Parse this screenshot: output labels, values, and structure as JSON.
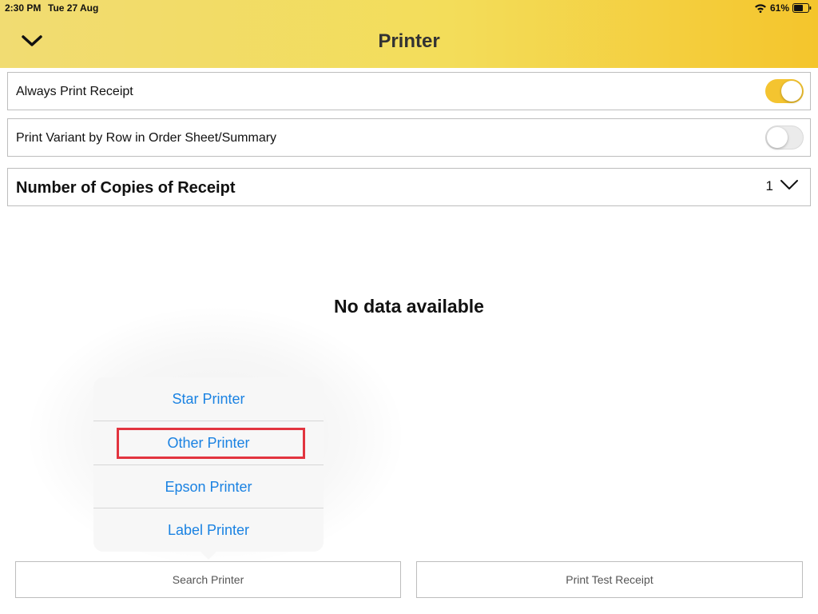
{
  "status_bar": {
    "time": "2:30 PM",
    "date": "Tue 27 Aug",
    "battery": "61%"
  },
  "header": {
    "title": "Printer",
    "back_icon": "chevron-down-icon",
    "background_colors": [
      "#f1dc72",
      "#f4c52c"
    ]
  },
  "settings": {
    "always_print_receipt": {
      "label": "Always Print Receipt",
      "enabled": true
    },
    "print_variant_by_row": {
      "label": "Print Variant by Row in Order Sheet/Summary",
      "enabled": false
    },
    "copies": {
      "label": "Number of Copies of Receipt",
      "value": "1"
    }
  },
  "empty_state": {
    "text": "No data available"
  },
  "printer_menu": {
    "items": [
      {
        "label": "Star Printer"
      },
      {
        "label": "Other Printer",
        "highlighted": true
      },
      {
        "label": "Epson Printer"
      },
      {
        "label": "Label Printer"
      }
    ],
    "item_color": "#1a82e2",
    "highlight_color": "#e2343f"
  },
  "buttons": {
    "search_printer": "Search Printer",
    "print_test_receipt": "Print Test Receipt"
  },
  "accent_color": "#f4c430"
}
